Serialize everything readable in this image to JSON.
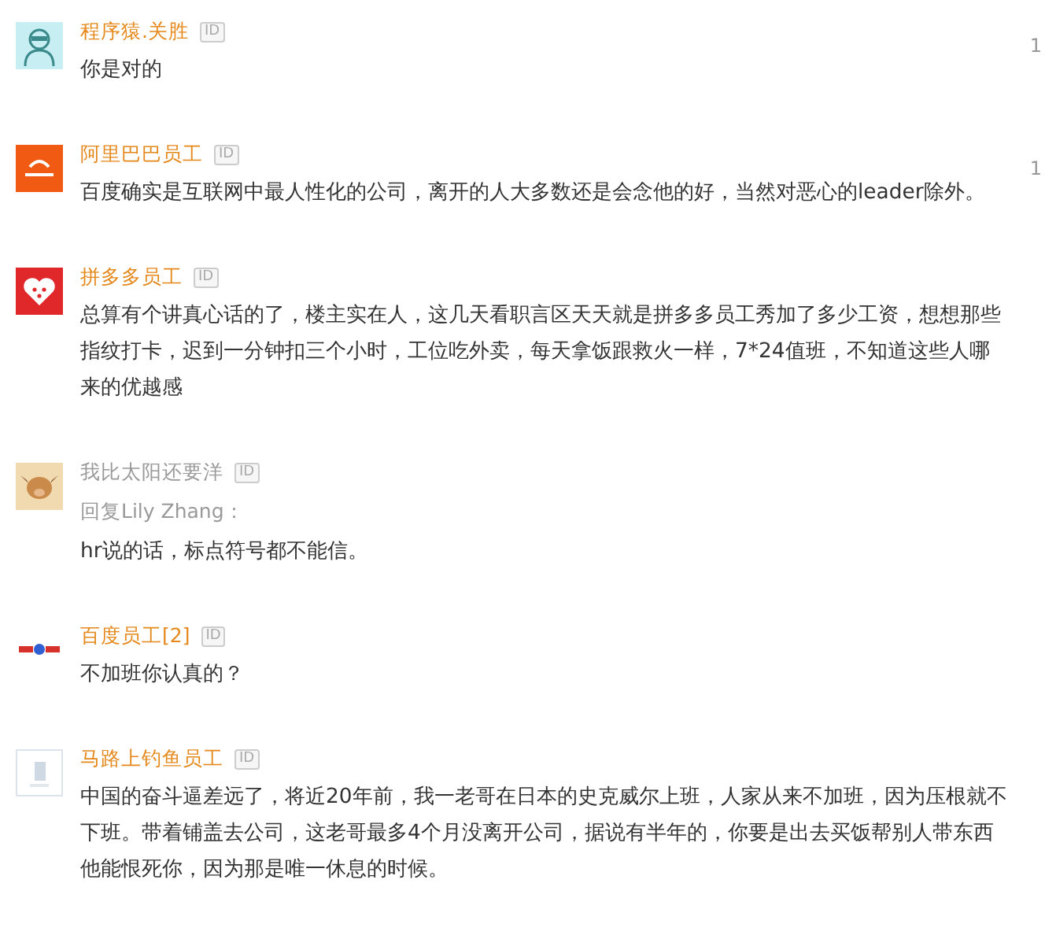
{
  "comments": [
    {
      "author": "程序猿.关胜",
      "kind": "employee",
      "badge": "ID",
      "text": "你是对的",
      "count": "1"
    },
    {
      "author": "阿里巴巴员工",
      "kind": "employee",
      "badge": "ID",
      "text": "百度确实是互联网中最人性化的公司，离开的人大多数还是会念他的好，当然对恶心的leader除外。",
      "count": "1"
    },
    {
      "author": "拼多多员工",
      "kind": "employee",
      "badge": "ID",
      "text": "总算有个讲真心话的了，楼主实在人，这几天看职言区天天就是拼多多员工秀加了多少工资，想想那些指纹打卡，迟到一分钟扣三个小时，工位吃外卖，每天拿饭跟救火一样，7*24值班，不知道这些人哪来的优越感"
    },
    {
      "author": "我比太阳还要洋",
      "kind": "user",
      "badge": "ID",
      "reply_to": "回复Lily Zhang：",
      "text": "hr说的话，标点符号都不能信。"
    },
    {
      "author": "百度员工[2]",
      "kind": "employee",
      "badge": "ID",
      "text": "不加班你认真的？"
    },
    {
      "author": "马路上钓鱼员工",
      "kind": "employee",
      "badge": "ID",
      "text": "中国的奋斗逼差远了，将近20年前，我一老哥在日本的史克威尔上班，人家从来不加班，因为压根就不下班。带着铺盖去公司，这老哥最多4个月没离开公司，据说有半年的，你要是出去买饭帮别人带东西他能恨死你，因为那是唯一休息的时候。"
    }
  ]
}
